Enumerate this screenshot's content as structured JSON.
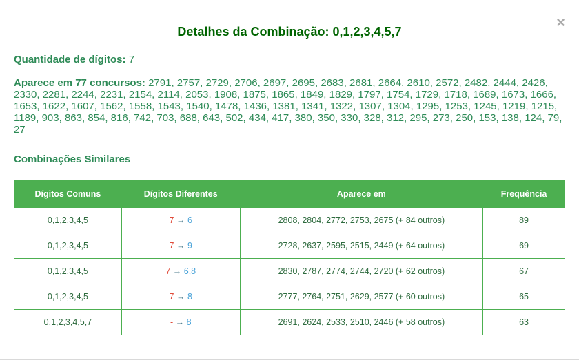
{
  "modal": {
    "title": "Detalhes da Combinação: 0,1,2,3,4,5,7",
    "close_icon": "×",
    "quantity_label": "Quantidade de dígitos:",
    "quantity_value": "7",
    "appears_label": "Aparece em 77 concursos:",
    "appears_value": "2791, 2757, 2729, 2706, 2697, 2695, 2683, 2681, 2664, 2610, 2572, 2482, 2444, 2426, 2330, 2281, 2244, 2231, 2154, 2114, 2053, 1908, 1875, 1865, 1849, 1829, 1797, 1754, 1729, 1718, 1689, 1673, 1666, 1653, 1622, 1607, 1562, 1558, 1543, 1540, 1478, 1436, 1381, 1341, 1322, 1307, 1304, 1295, 1253, 1245, 1219, 1215, 1189, 903, 863, 854, 816, 742, 703, 688, 643, 502, 434, 417, 380, 350, 330, 328, 312, 295, 273, 250, 153, 138, 124, 79, 27",
    "similar_title": "Combinações Similares"
  },
  "table": {
    "headers": [
      "Dígitos Comuns",
      "Dígitos Diferentes",
      "Aparece em",
      "Frequência"
    ],
    "rows": [
      {
        "common": "0,1,2,3,4,5",
        "from": "7",
        "arrow": "→",
        "to": "6",
        "appears": "2808, 2804, 2772, 2753, 2675 (+ 84 outros)",
        "freq": "89"
      },
      {
        "common": "0,1,2,3,4,5",
        "from": "7",
        "arrow": "→",
        "to": "9",
        "appears": "2728, 2637, 2595, 2515, 2449 (+ 64 outros)",
        "freq": "69"
      },
      {
        "common": "0,1,2,3,4,5",
        "from": "7",
        "arrow": "→",
        "to": "6,8",
        "appears": "2830, 2787, 2774, 2744, 2720 (+ 62 outros)",
        "freq": "67"
      },
      {
        "common": "0,1,2,3,4,5",
        "from": "7",
        "arrow": "→",
        "to": "8",
        "appears": "2777, 2764, 2751, 2629, 2577 (+ 60 outros)",
        "freq": "65"
      },
      {
        "common": "0,1,2,3,4,5,7",
        "from": "-",
        "arrow": "→",
        "to": "8",
        "appears": "2691, 2624, 2533, 2510, 2446 (+ 58 outros)",
        "freq": "63"
      }
    ]
  }
}
